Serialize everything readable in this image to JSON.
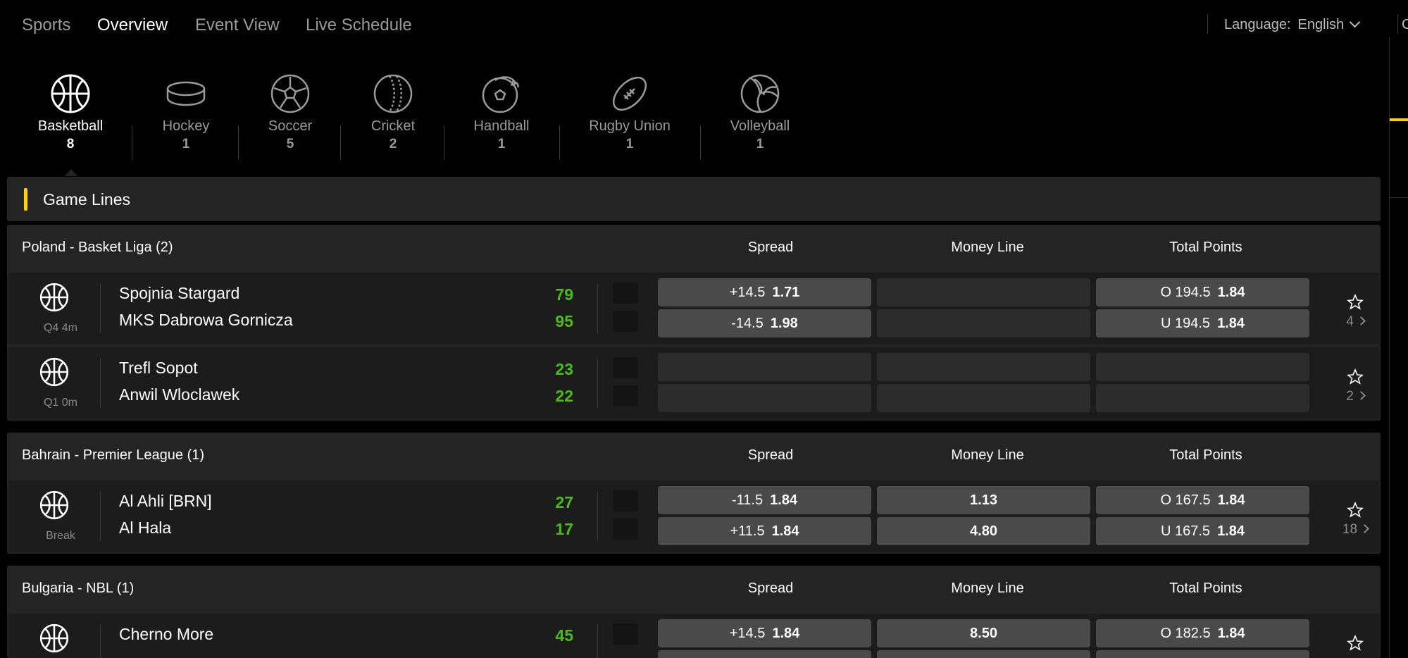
{
  "nav": {
    "items": [
      "Sports",
      "Overview",
      "Event View",
      "Live Schedule"
    ],
    "active_index": 1
  },
  "language": {
    "label": "Language:",
    "value": "English",
    "clipped_letter": "C"
  },
  "sports": [
    {
      "name": "Basketball",
      "count": "8",
      "icon": "basketball-icon"
    },
    {
      "name": "Hockey",
      "count": "1",
      "icon": "hockey-puck-icon"
    },
    {
      "name": "Soccer",
      "count": "5",
      "icon": "soccer-ball-icon"
    },
    {
      "name": "Cricket",
      "count": "2",
      "icon": "cricket-ball-icon"
    },
    {
      "name": "Handball",
      "count": "1",
      "icon": "handball-icon"
    },
    {
      "name": "Rugby Union",
      "count": "1",
      "icon": "rugby-ball-icon"
    },
    {
      "name": "Volleyball",
      "count": "1",
      "icon": "volleyball-icon"
    }
  ],
  "section_title": "Game Lines",
  "columns": [
    "Spread",
    "Money Line",
    "Total Points"
  ],
  "leagues": [
    {
      "name": "Poland - Basket Liga (2)",
      "events": [
        {
          "status": "Q4 4m",
          "teams": [
            "Spojnia Stargard",
            "MKS Dabrowa Gornicza"
          ],
          "scores": [
            "79",
            "95"
          ],
          "spread": [
            {
              "line": "+14.5",
              "price": "1.71"
            },
            {
              "line": "-14.5",
              "price": "1.98"
            }
          ],
          "moneyline": [
            "",
            ""
          ],
          "total": [
            {
              "line": "O 194.5",
              "price": "1.84"
            },
            {
              "line": "U 194.5",
              "price": "1.84"
            }
          ],
          "markets": "4"
        },
        {
          "status": "Q1 0m",
          "teams": [
            "Trefl Sopot",
            "Anwil Wloclawek"
          ],
          "scores": [
            "23",
            "22"
          ],
          "spread": [
            {
              "line": "",
              "price": ""
            },
            {
              "line": "",
              "price": ""
            }
          ],
          "moneyline": [
            "",
            ""
          ],
          "total": [
            {
              "line": "",
              "price": ""
            },
            {
              "line": "",
              "price": ""
            }
          ],
          "markets": "2"
        }
      ]
    },
    {
      "name": "Bahrain - Premier League (1)",
      "events": [
        {
          "status": "Break",
          "teams": [
            "Al Ahli [BRN]",
            "Al Hala"
          ],
          "scores": [
            "27",
            "17"
          ],
          "spread": [
            {
              "line": "-11.5",
              "price": "1.84"
            },
            {
              "line": "+11.5",
              "price": "1.84"
            }
          ],
          "moneyline": [
            "1.13",
            "4.80"
          ],
          "total": [
            {
              "line": "O 167.5",
              "price": "1.84"
            },
            {
              "line": "U 167.5",
              "price": "1.84"
            }
          ],
          "markets": "18"
        }
      ]
    },
    {
      "name": "Bulgaria - NBL (1)",
      "events": [
        {
          "status": "",
          "teams": [
            "Cherno More",
            ""
          ],
          "scores": [
            "45",
            ""
          ],
          "spread": [
            {
              "line": "+14.5",
              "price": "1.84"
            },
            {
              "line": "",
              "price": ""
            }
          ],
          "moneyline": [
            "8.50",
            ""
          ],
          "total": [
            {
              "line": "O 182.5",
              "price": "1.84"
            },
            {
              "line": "",
              "price": ""
            }
          ],
          "markets": ""
        }
      ]
    }
  ]
}
